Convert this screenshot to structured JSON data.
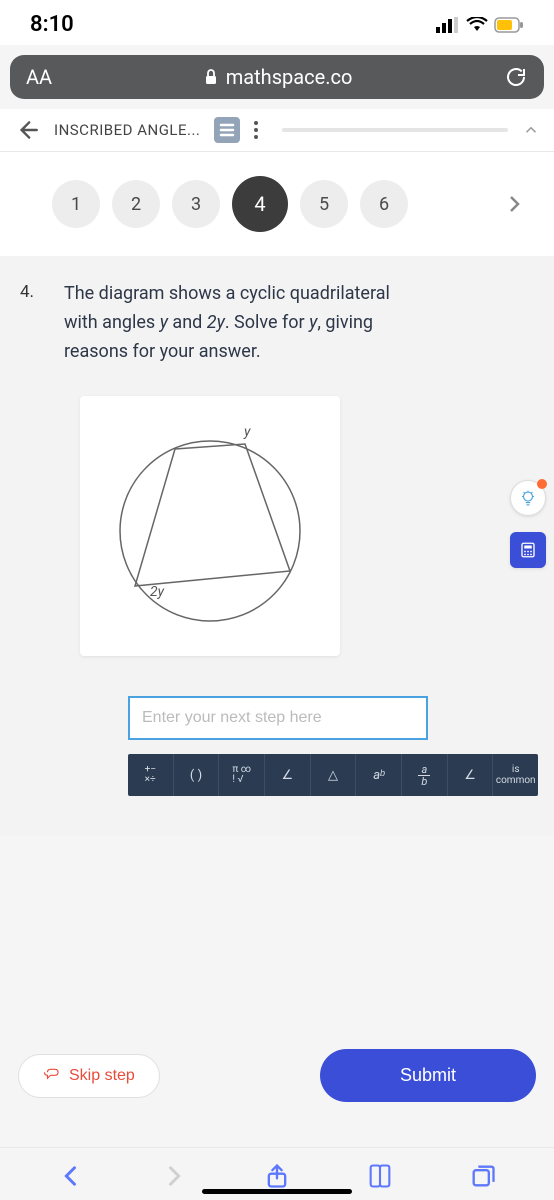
{
  "status": {
    "time": "8:10"
  },
  "url_bar": {
    "aa": "AA",
    "domain": "mathspace.co"
  },
  "nav": {
    "title": "INSCRIBED ANGLE..."
  },
  "tabs": {
    "items": [
      "1",
      "2",
      "3",
      "4",
      "5",
      "6"
    ],
    "active_index": 3
  },
  "question": {
    "number": "4.",
    "text_parts": {
      "p1": "The diagram shows a cyclic quadrilateral with angles ",
      "y": "y",
      "and": " and ",
      "two_y": "2y",
      "p2": ". Solve for ",
      "y2": "y",
      "p3": ", giving reasons for your answer."
    },
    "diagram_labels": {
      "top": "y",
      "bottom": "2y"
    }
  },
  "input": {
    "placeholder": "Enter your next step here"
  },
  "toolbar": {
    "ops": "+−\n×÷",
    "paren": "( )",
    "pi": "π ∞\n! √",
    "angle1": "∠",
    "angle2": "△",
    "power": "aᵇ",
    "frac": "a/b",
    "angle3": "∠",
    "common_top": "is",
    "common_bottom": "common"
  },
  "actions": {
    "skip": "Skip step",
    "submit": "Submit"
  }
}
